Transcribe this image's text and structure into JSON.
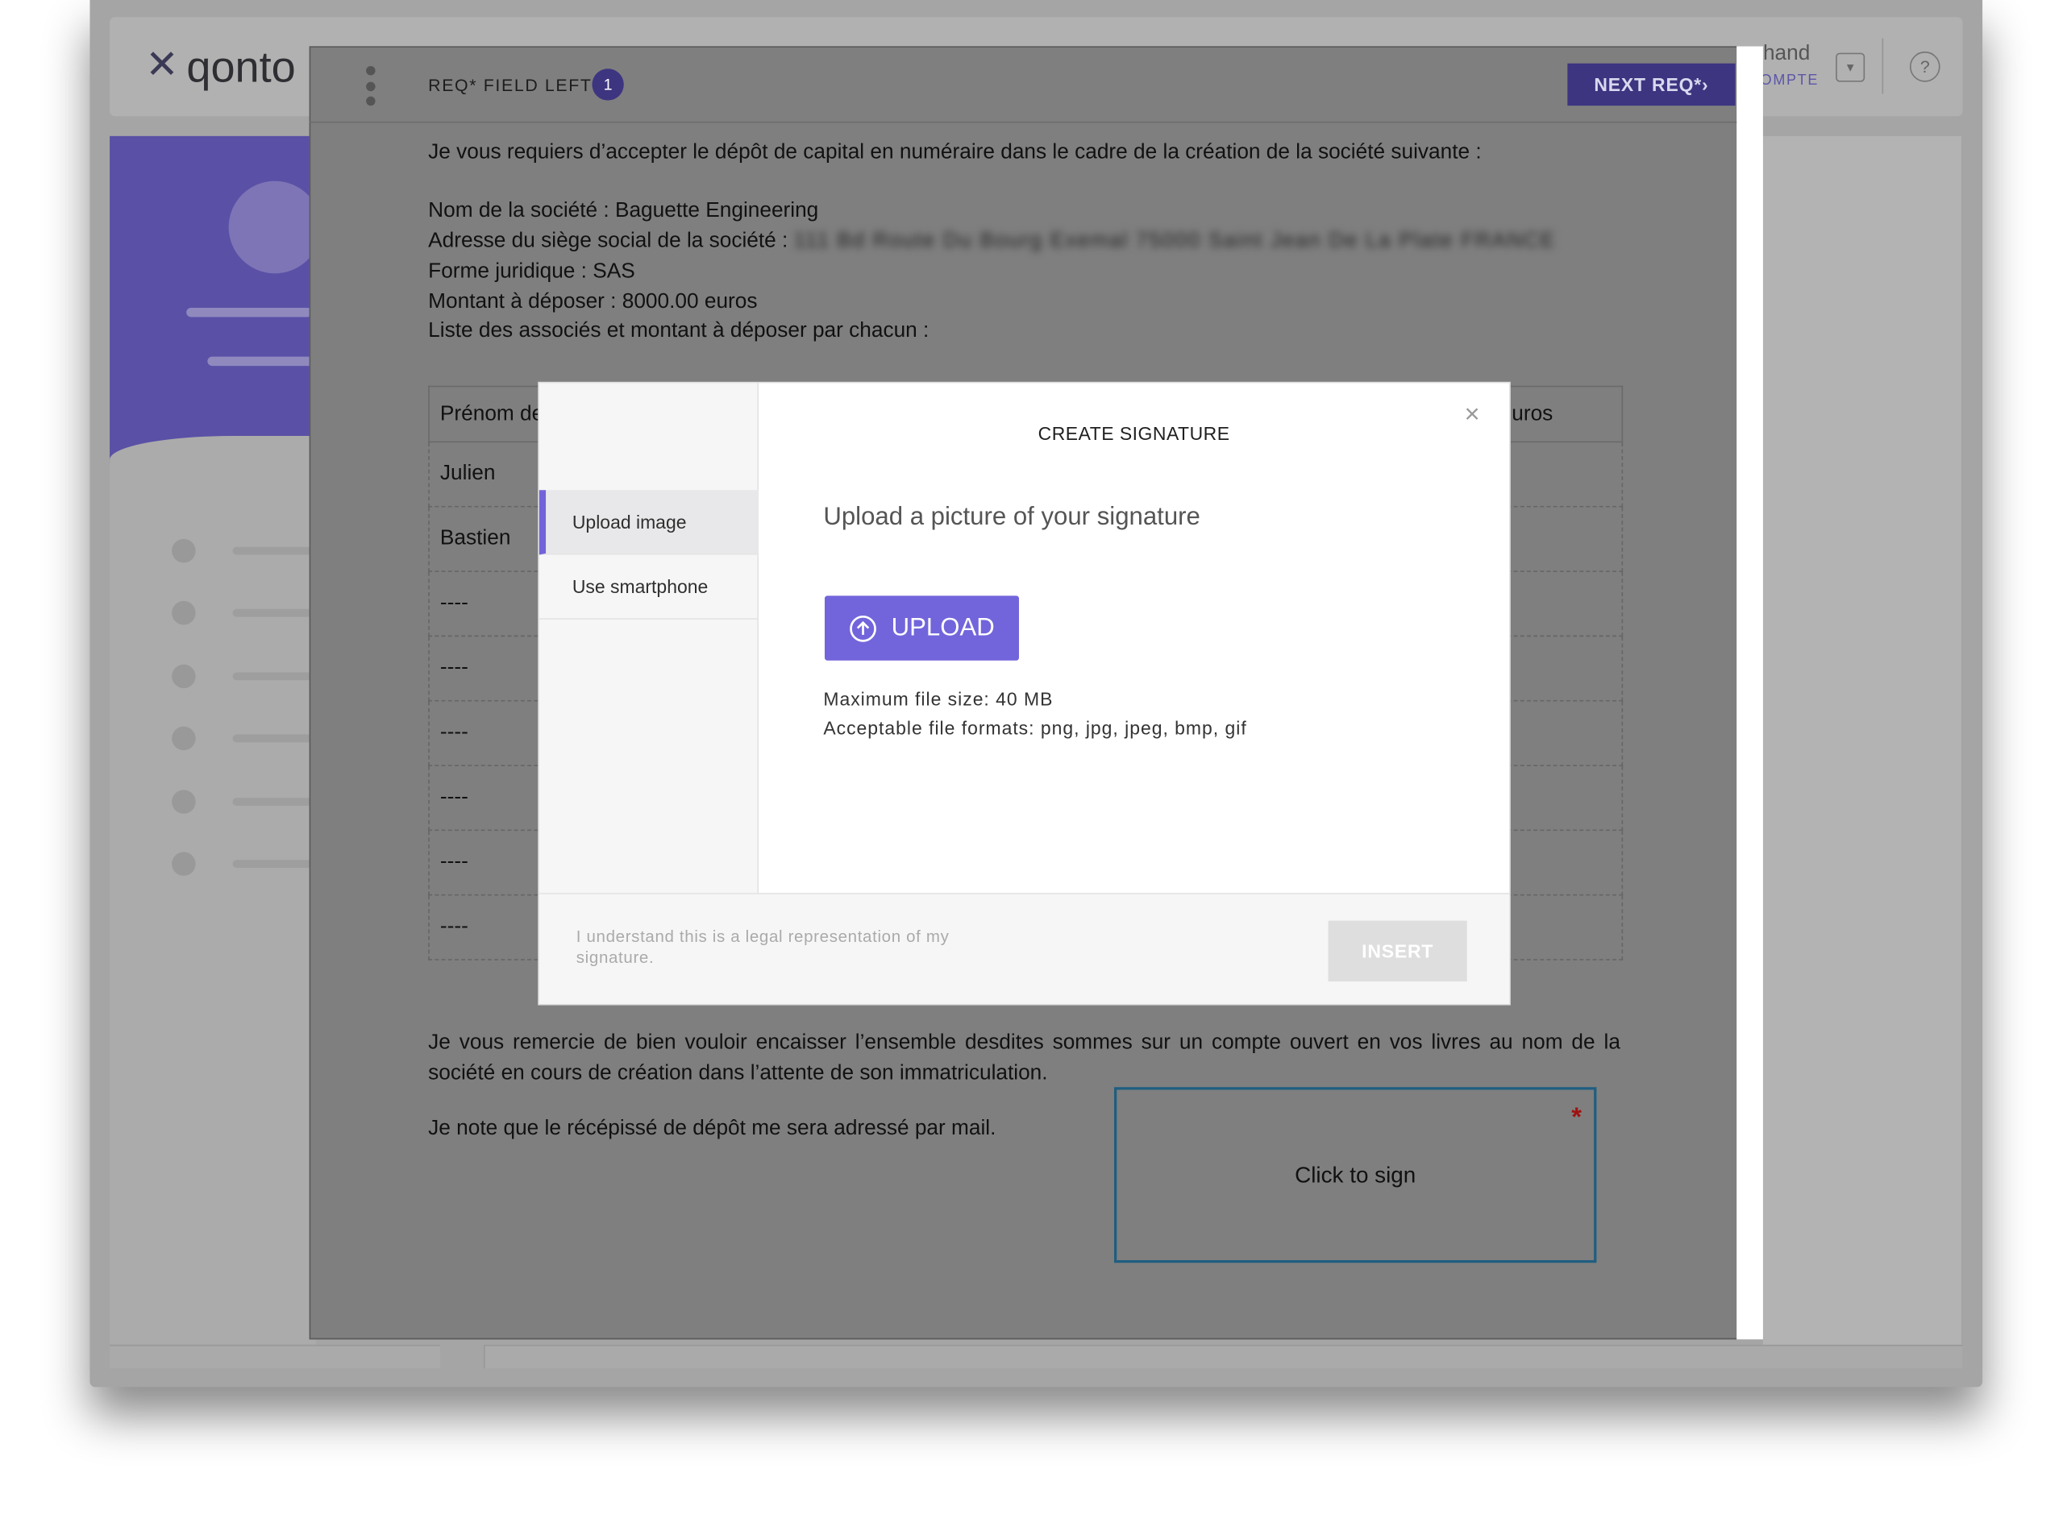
{
  "app": {
    "logo_mark": "✕",
    "logo_text": "qonto",
    "user_name": "hand",
    "user_sub": "OMPTE"
  },
  "doc_header": {
    "req_label": "REQ* FIELD LEFT",
    "req_count": "1",
    "next_label": "NEXT REQ*›"
  },
  "document": {
    "intro": "Je vous requiers d’accepter le dépôt de capital en numéraire dans le cadre de la création de la société suivante :",
    "company_name": "Nom de la société : Baguette  Engineering",
    "address_label": "Adresse du siège social de la société :",
    "address_value": "111 Bd Route Du Bourg Exemal 75000 Saint Jean De La Plate FRANCE",
    "legal_form": "Forme juridique :  SAS",
    "amount": "Montant à déposer : 8000.00  euros",
    "partners_intro": "Liste des associés et montant à déposer par chacun :",
    "table": {
      "header_left": "Prénom de",
      "header_right": "uros",
      "rows": [
        "Julien",
        "Bastien",
        "----",
        "----",
        "----",
        "----",
        "----",
        "----"
      ]
    },
    "thanks": "Je vous remercie de bien vouloir encaisser l’ensemble desdites sommes sur un compte ouvert en vos livres au nom de la société en cours de création dans l’attente de son immatriculation.",
    "receipt_note": "Je note que le récépissé de dépôt me sera adressé par mail.",
    "sign_label": "Click to sign",
    "sign_star": "*"
  },
  "modal": {
    "title": "CREATE SIGNATURE",
    "close": "×",
    "tabs": [
      {
        "label": "Upload image",
        "active": true
      },
      {
        "label": "Use smartphone",
        "active": false
      }
    ],
    "subtitle": "Upload a picture of your signature",
    "upload_label": "UPLOAD",
    "max_size": "Maximum file size: 40 MB",
    "formats": "Acceptable file formats: png, jpg, jpeg, bmp, gif",
    "legal": "I understand this is a legal representation of my signature.",
    "insert_label": "INSERT"
  },
  "colors": {
    "accent": "#7265db",
    "overlay_button": "#3d3580",
    "sign_border": "#1f5e80",
    "required_star": "#a11111"
  },
  "icons": [
    "menu-kebab-icon",
    "chevron-down-icon",
    "help-icon",
    "upload-arrow-icon",
    "close-icon"
  ]
}
